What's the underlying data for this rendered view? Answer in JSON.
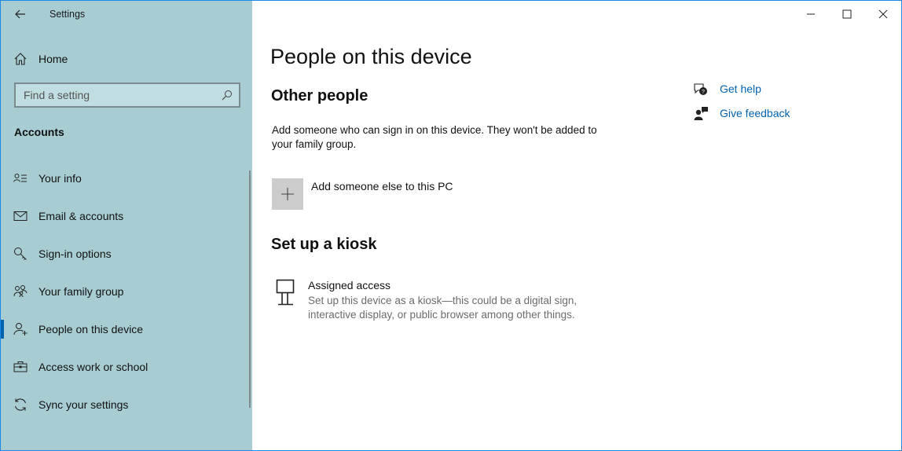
{
  "window": {
    "app_title": "Settings"
  },
  "sidebar": {
    "home_label": "Home",
    "search_placeholder": "Find a setting",
    "section_label": "Accounts",
    "items": [
      {
        "label": "Your info",
        "icon": "contact-card-icon"
      },
      {
        "label": "Email & accounts",
        "icon": "mail-icon"
      },
      {
        "label": "Sign-in options",
        "icon": "key-icon"
      },
      {
        "label": "Your family group",
        "icon": "family-icon"
      },
      {
        "label": "People on this device",
        "icon": "person-add-icon",
        "selected": true
      },
      {
        "label": "Access work or school",
        "icon": "briefcase-icon"
      },
      {
        "label": "Sync your settings",
        "icon": "sync-icon"
      }
    ]
  },
  "main": {
    "page_title": "People on this device",
    "other_people": {
      "heading": "Other people",
      "description": "Add someone who can sign in on this device. They won't be added to your family group.",
      "add_label": "Add someone else to this PC"
    },
    "kiosk": {
      "heading": "Set up a kiosk",
      "title": "Assigned access",
      "description": "Set up this device as a kiosk—this could be a digital sign, interactive display, or public browser among other things."
    },
    "help": {
      "get_help": "Get help",
      "give_feedback": "Give feedback"
    }
  },
  "colors": {
    "sidebar_bg": "#a7cdd3",
    "accent": "#0063b1",
    "link": "#0063b1"
  }
}
